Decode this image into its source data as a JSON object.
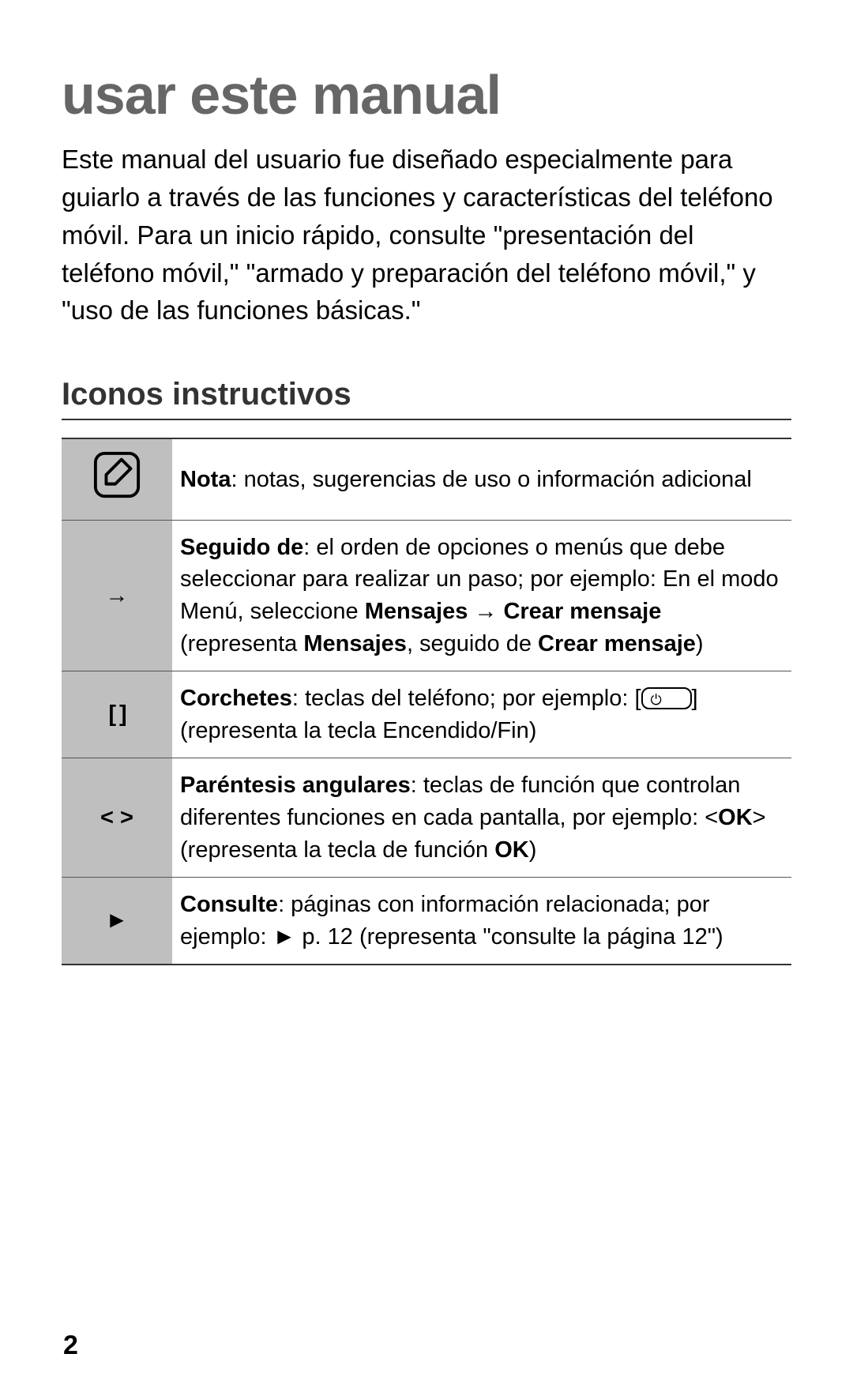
{
  "title": "usar este manual",
  "intro": "Este manual del usuario fue diseñado especialmente para guiarlo a través de las funciones y características del teléfono móvil. Para un inicio rápido, consulte \"presentación del teléfono móvil,\" \"armado y preparación del teléfono móvil,\" y \"uso de las funciones básicas.\"",
  "section_heading": "Iconos instructivos",
  "rows": {
    "note": {
      "symbol": "note-icon",
      "label_bold": "Nota",
      "label_rest": ": notas, sugerencias de uso o información adicional"
    },
    "followed": {
      "symbol": "→",
      "label_bold": "Seguido de",
      "label_rest1": ": el orden de opciones o menús que debe seleccionar para realizar un paso; por ejemplo: En el modo Menú, seleccione ",
      "msg": "Mensajes",
      "arrow": " → ",
      "crear": "Crear mensaje",
      "label_rest2": " (representa ",
      "msg2": "Mensajes",
      "label_rest3": ", seguido de ",
      "crear2": "Crear mensaje",
      "label_rest4": ")"
    },
    "brackets": {
      "symbol": "[    ]",
      "label_bold": "Corchetes",
      "label_rest1": ": teclas del teléfono; por ejemplo: [",
      "label_rest2": "] (representa la tecla Encendido/Fin)"
    },
    "angle": {
      "symbol": "<    >",
      "label_bold": "Paréntesis angulares",
      "label_rest1": ": teclas de función que controlan diferentes funciones en cada pantalla, por ejemplo: <",
      "ok": "OK",
      "label_rest2": "> (representa la tecla de función ",
      "ok2": "OK",
      "label_rest3": ")"
    },
    "refer": {
      "symbol": "►",
      "label_bold": "Consulte",
      "label_rest": ": páginas con información relacionada; por ejemplo: ► p. 12 (representa \"consulte la página 12\")"
    }
  },
  "page_number": "2"
}
